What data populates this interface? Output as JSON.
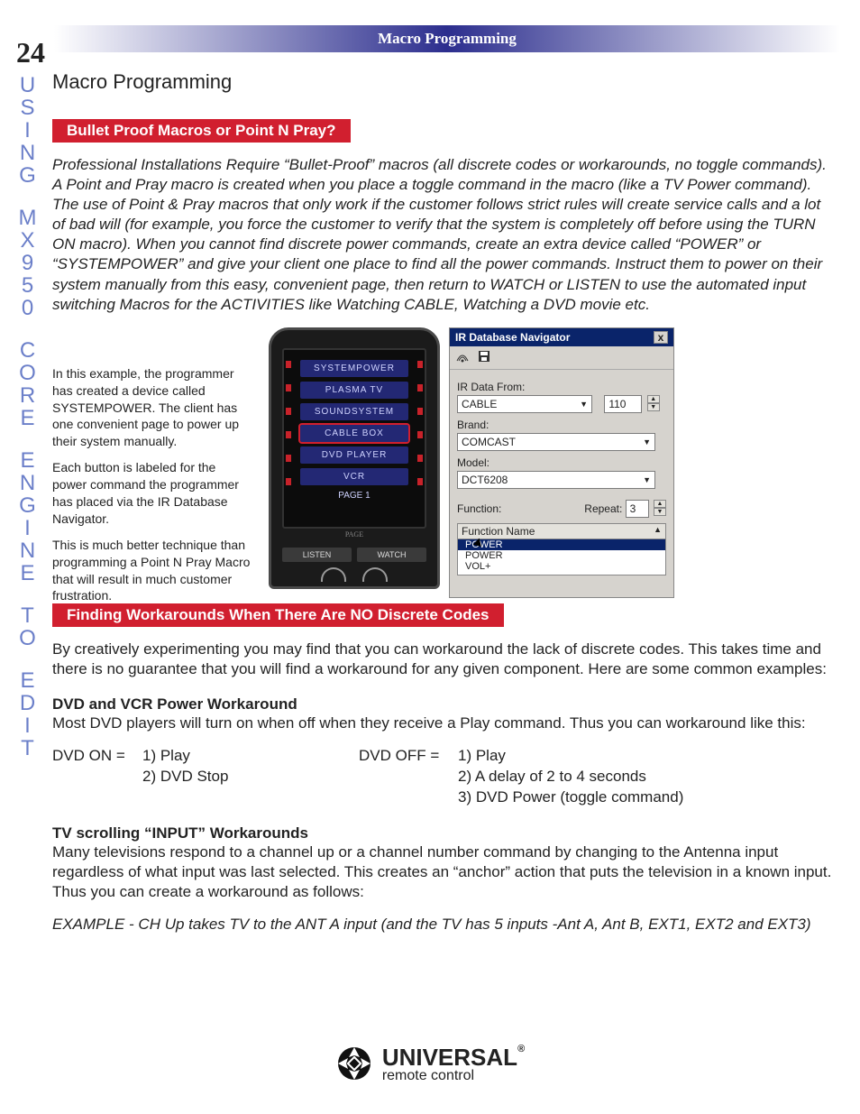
{
  "header_bar": "Macro Programming",
  "page_number": "24",
  "side_rail": {
    "words": [
      "USING",
      "MX950",
      "CORE",
      "ENGINE",
      "TO",
      "EDIT"
    ]
  },
  "section_title": "Macro Programming",
  "subhead_1": "Bullet Proof Macros or Point N Pray?",
  "para_1": "Professional Installations Require “Bullet-Proof” macros (all discrete codes or workarounds, no toggle commands). A Point and Pray macro is created when you place a toggle command in the macro (like a TV Power command). The use of Point & Pray macros that only work if the customer follows strict rules will create service calls and a lot of bad will (for example, you force the customer to verify that the system is completely off before using the TURN ON macro). When you cannot find discrete power commands, create an extra device called “POWER” or “SYSTEMPOWER” and give your client one place to find all the power commands. Instruct them to power on their system manually from this easy, convenient page, then return to WATCH or LISTEN to use the automated input switching Macros for the ACTIVITIES like Watching CABLE, Watching a DVD movie etc.",
  "example": {
    "caption_1": "In this example, the programmer has created a device called SYSTEMPOWER. The client has one convenient page to power up their system manually.",
    "caption_2": "Each button is labeled for the power command the programmer has placed via the IR Database Navigator.",
    "caption_3": "This is much better technique than programming a Point N Pray Macro that will result in much customer frustration.",
    "remote": {
      "buttons": [
        "SYSTEMPOWER",
        "PLASMA TV",
        "SOUNDSYSTEM",
        "CABLE BOX",
        "DVD PLAYER",
        "VCR"
      ],
      "page_label": "PAGE 1",
      "page_hint": "PAGE",
      "footer_left": "LISTEN",
      "footer_right": "WATCH"
    },
    "navigator": {
      "title": "IR Database Navigator",
      "label_irdata": "IR Data From:",
      "field_irdata": "CABLE",
      "field_irnum": "110",
      "label_brand": "Brand:",
      "field_brand": "COMCAST",
      "label_model": "Model:",
      "field_model": "DCT6208",
      "label_function": "Function:",
      "label_repeat": "Repeat:",
      "field_repeat": "3",
      "func_header": "Function Name",
      "func_items": [
        "POWER",
        "POWER",
        "VOL+"
      ]
    }
  },
  "subhead_2": "Finding Workarounds When There Are NO Discrete Codes",
  "para_2": "By creatively experimenting you may find that you can workaround the lack of discrete codes. This takes time and there is no guarantee that you will find a workaround for any given component.  Here are some common examples:",
  "dvd_head": "DVD and  VCR Power Workaround",
  "dvd_body": "Most DVD players will turn on when off when they receive a Play command. Thus you can workaround like this:",
  "dvd_on": {
    "label": "DVD ON =",
    "lines": [
      "1) Play",
      "2) DVD Stop"
    ]
  },
  "dvd_off": {
    "label": "DVD OFF   =",
    "lines": [
      "1) Play",
      "2) A delay of 2 to 4 seconds",
      "3) DVD Power (toggle command)"
    ]
  },
  "tv_head": "TV scrolling “INPUT” Workarounds",
  "tv_body": "Many televisions respond to a channel up or a channel number command by changing to the Antenna input regardless of what input was last selected. This creates an “anchor” action that puts the television in a known input. Thus you can create a workaround as follows:",
  "tv_example": "EXAMPLE - CH Up takes TV to the ANT A input (and the TV has 5 inputs -Ant A, Ant B, EXT1, EXT2 and EXT3)",
  "logo": {
    "brand": "UNIVERSAL",
    "sub": "remote control",
    "reg": "®"
  }
}
